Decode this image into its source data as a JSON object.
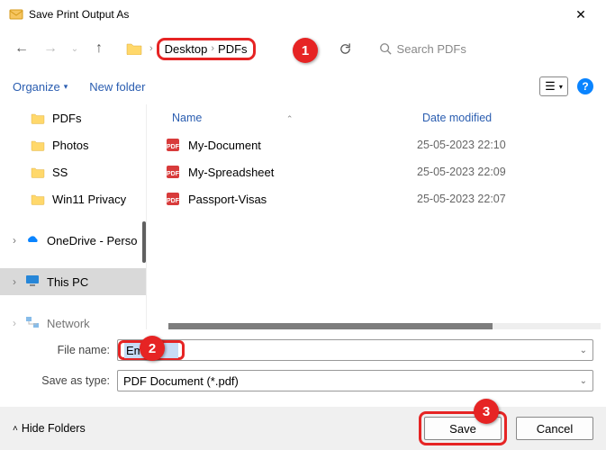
{
  "window": {
    "title": "Save Print Output As"
  },
  "breadcrumb": {
    "seg1": "Desktop",
    "seg2": "PDFs"
  },
  "search": {
    "placeholder": "Search PDFs"
  },
  "toolbar": {
    "organize": "Organize",
    "newfolder": "New folder",
    "view_glyph": "☰"
  },
  "sidebar": {
    "items": [
      {
        "label": "PDFs",
        "kind": "folder"
      },
      {
        "label": "Photos",
        "kind": "folder"
      },
      {
        "label": "SS",
        "kind": "folder"
      },
      {
        "label": "Win11 Privacy",
        "kind": "folder"
      },
      {
        "label": "OneDrive - Perso",
        "kind": "onedrive",
        "expand": true
      },
      {
        "label": "This PC",
        "kind": "pc",
        "expand": true,
        "selected": true
      },
      {
        "label": "Network",
        "kind": "network",
        "expand": true
      }
    ]
  },
  "columns": {
    "name": "Name",
    "date": "Date modified"
  },
  "files": [
    {
      "name": "My-Document",
      "date": "25-05-2023 22:10"
    },
    {
      "name": "My-Spreadsheet",
      "date": "25-05-2023 22:09"
    },
    {
      "name": "Passport-Visas",
      "date": "25-05-2023 22:07"
    }
  ],
  "fields": {
    "filename_label": "File name:",
    "filename_value": "Email",
    "saveastype_label": "Save as type:",
    "saveastype_value": "PDF Document (*.pdf)"
  },
  "bottom": {
    "hidefolders": "Hide Folders",
    "save": "Save",
    "cancel": "Cancel"
  },
  "callouts": {
    "c1": "1",
    "c2": "2",
    "c3": "3"
  }
}
